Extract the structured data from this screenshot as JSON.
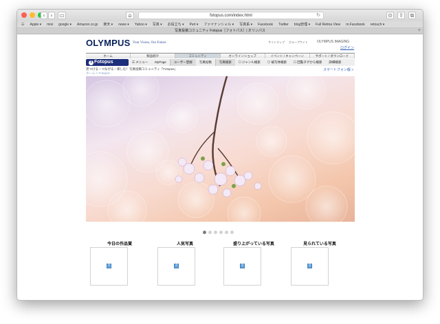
{
  "browser": {
    "url": "fotopus.com/index.html",
    "tab_title": "写真投稿コミュニティ Fotopus［フォトパス］| オリンパス",
    "bookmarks": [
      "Apple ▾",
      "mixi",
      "google ▾",
      "Amazon.co.jp",
      "楽天 ▾",
      "news ▾",
      "Yahoo ▾",
      "写真 ▾",
      "お役立ち ▾",
      "Perl ▾",
      "ファイナンシャル ▾",
      "写真系 ▾",
      "Facebook",
      "Twitter",
      "blog管理 ▾",
      "Full Retina View",
      "m.Facebook",
      "retouch ▾"
    ]
  },
  "header": {
    "logo": "OLYMPUS",
    "tagline": "Your Vision, Our Future",
    "links": [
      "サイトマップ",
      "グループサイト"
    ],
    "imaging": "OLYMPUS IMAGING",
    "login": "ログイン"
  },
  "main_nav": [
    {
      "label": "ホーム",
      "active": false
    },
    {
      "label": "製品紹介",
      "active": false
    },
    {
      "label": "コミュニティ",
      "active": true
    },
    {
      "label": "オンラインショップ",
      "active": false
    },
    {
      "label": "イベント / キャンペーン",
      "active": false
    },
    {
      "label": "サポート / ダウンロード",
      "active": false
    }
  ],
  "sub_nav": {
    "brand": "Fotopus",
    "items": [
      "☰ メニュー",
      "MyPage",
      "ユーザー登録",
      "写真投稿",
      "写真検索",
      "☐ ジャンル検索",
      "◎ 被写体検索",
      "☐ 回覧タグから検索",
      "詳細検索"
    ]
  },
  "breadcrumb": {
    "tagline": "見つける・つながる・楽しむ！写真投稿コミュニティ「Fotopus」",
    "path": "ホーム > Fotopus"
  },
  "smartphone_link": "スマートフォン版 »",
  "carousel": {
    "dot_count": 6,
    "active_index": 0
  },
  "sections": [
    {
      "title": "今日の作品賞"
    },
    {
      "title": "人気写真"
    },
    {
      "title": "盛り上がっている写真"
    },
    {
      "title": "見られている写真"
    }
  ],
  "colors": {
    "brand_navy": "#08215c",
    "link_blue": "#2a57b8",
    "fotopus_blue": "#1d2e7a"
  }
}
